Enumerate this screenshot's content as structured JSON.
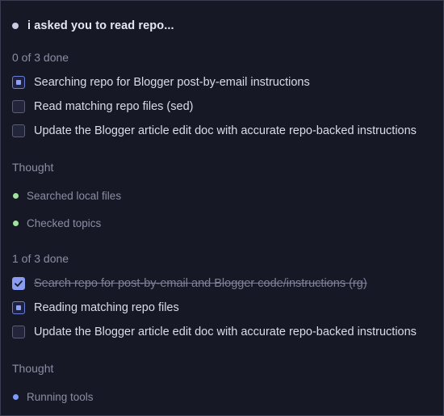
{
  "header": {
    "title": "i asked you to read repo..."
  },
  "groups": [
    {
      "progress": "0 of 3 done",
      "tasks": [
        {
          "label": "Searching repo for Blogger post-by-email instructions",
          "state": "in-progress"
        },
        {
          "label": "Read matching repo files (sed)",
          "state": "pending"
        },
        {
          "label": "Update the Blogger article edit doc with accurate repo-backed instructions",
          "state": "pending"
        }
      ]
    },
    {
      "progress": "1 of 3 done",
      "tasks": [
        {
          "label": "Search repo for post-by-email and Blogger code/instructions (rg)",
          "state": "done"
        },
        {
          "label": "Reading matching repo files",
          "state": "in-progress"
        },
        {
          "label": "Update the Blogger article edit doc with accurate repo-backed instructions",
          "state": "pending"
        }
      ]
    }
  ],
  "thoughts": [
    {
      "label": "Thought",
      "items": [
        {
          "text": "Searched local files",
          "status": "complete",
          "color": "#9fe39a"
        },
        {
          "text": "Checked topics",
          "status": "complete",
          "color": "#9fe39a"
        }
      ]
    },
    {
      "label": "Thought",
      "items": [
        {
          "text": "Running tools",
          "status": "running",
          "color": "#7f9cf5"
        }
      ]
    }
  ],
  "colors": {
    "background": "#171826",
    "accent": "#8a9cf0",
    "muted_text": "#8b8ea3"
  }
}
